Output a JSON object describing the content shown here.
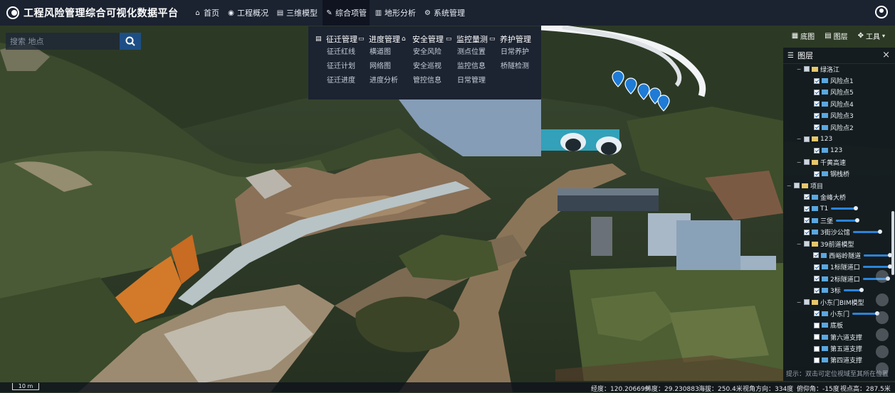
{
  "app_title": "工程风险管理综合可视化数据平台",
  "nav": [
    {
      "label": "首页",
      "icon": "home-icon"
    },
    {
      "label": "工程概况",
      "icon": "eye-icon"
    },
    {
      "label": "三维模型",
      "icon": "document-icon"
    },
    {
      "label": "综合项管",
      "icon": "pencil-icon"
    },
    {
      "label": "地形分析",
      "icon": "chart-icon"
    },
    {
      "label": "系统管理",
      "icon": "gear-icon"
    }
  ],
  "search": {
    "placeholder": "搜索 地点"
  },
  "dropdown": {
    "columns": [
      {
        "header": "征迁管理",
        "icon": "document-icon",
        "items": [
          "征迁红线",
          "征迁计划",
          "征迁进度"
        ]
      },
      {
        "header": "进度管理",
        "icon": "folder-icon",
        "items": [
          "横道图",
          "网络图",
          "进度分析"
        ]
      },
      {
        "header": "安全管理",
        "icon": "bank-icon",
        "items": [
          "安全风险",
          "安全巡视",
          "管控信息"
        ]
      },
      {
        "header": "监控量测",
        "icon": "folder-icon",
        "items": [
          "测点位置",
          "监控信息",
          "日常管理"
        ]
      },
      {
        "header": "养护管理",
        "icon": "folder-icon",
        "items": [
          "日常养护",
          "桥隧检测"
        ]
      }
    ]
  },
  "tools": [
    {
      "label": "底图",
      "icon": "map-icon"
    },
    {
      "label": "图层",
      "icon": "layers-icon"
    },
    {
      "label": "工具",
      "icon": "tools-icon"
    }
  ],
  "layer_panel": {
    "title": "图层",
    "hint": "提示：双击可定位视域至其所在位置",
    "rows": [
      {
        "label": "绿洛江",
        "level": 1,
        "kind": "folder",
        "check": "part",
        "toggle": "⊟"
      },
      {
        "label": "风险点1",
        "level": 2,
        "kind": "item",
        "check": "on"
      },
      {
        "label": "风险点5",
        "level": 2,
        "kind": "item",
        "check": "on"
      },
      {
        "label": "风险点4",
        "level": 2,
        "kind": "item",
        "check": "on"
      },
      {
        "label": "风险点3",
        "level": 2,
        "kind": "item",
        "check": "on"
      },
      {
        "label": "风险点2",
        "level": 2,
        "kind": "item",
        "check": "on"
      },
      {
        "label": "123",
        "level": 1,
        "kind": "folder",
        "check": "part",
        "toggle": "⊟"
      },
      {
        "label": "123",
        "level": 2,
        "kind": "item",
        "check": "on"
      },
      {
        "label": "千黄高速",
        "level": 1,
        "kind": "folder",
        "check": "part",
        "toggle": "⊟"
      },
      {
        "label": "钢栈桥",
        "level": 2,
        "kind": "item",
        "check": "on"
      },
      {
        "label": "项目",
        "level": 0,
        "kind": "folder",
        "check": "part",
        "toggle": "⊟"
      },
      {
        "label": "金峰大桥",
        "level": 1,
        "kind": "item",
        "check": "on"
      },
      {
        "label": "T1",
        "level": 1,
        "kind": "item",
        "check": "on",
        "slider": 0.7
      },
      {
        "label": "三堡",
        "level": 1,
        "kind": "item",
        "check": "on",
        "slider": 0.6
      },
      {
        "label": "3街沙公馆",
        "level": 1,
        "kind": "item",
        "check": "on",
        "slider": 0.75
      },
      {
        "label": "39前道模型",
        "level": 1,
        "kind": "folder",
        "check": "part",
        "toggle": "⊟"
      },
      {
        "label": "西峪岭隧道",
        "level": 2,
        "kind": "item",
        "check": "on",
        "slider": 0.8
      },
      {
        "label": "1标隧道口",
        "level": 2,
        "kind": "item",
        "check": "on",
        "slider": 0.75
      },
      {
        "label": "2标隧道口",
        "level": 2,
        "kind": "item",
        "check": "on",
        "slider": 0.7
      },
      {
        "label": "3标",
        "level": 2,
        "kind": "item",
        "check": "on",
        "slider": 0.5
      },
      {
        "label": "小东门BIM模型",
        "level": 1,
        "kind": "folder",
        "check": "part",
        "toggle": "⊟"
      },
      {
        "label": "小东门",
        "level": 2,
        "kind": "item",
        "check": "on",
        "slider": 0.7
      },
      {
        "label": "底板",
        "level": 2,
        "kind": "item",
        "check": "off"
      },
      {
        "label": "第六道支撑",
        "level": 2,
        "kind": "item",
        "check": "off"
      },
      {
        "label": "第五道支撑",
        "level": 2,
        "kind": "item",
        "check": "off"
      },
      {
        "label": "第四道支撑",
        "level": 2,
        "kind": "item",
        "check": "off"
      }
    ]
  },
  "status": {
    "scale": "10 m",
    "lon": "经度：120.206699",
    "lat": "纬度：29.230883",
    "alt": "海拔：250.4米",
    "heading": "视角方向：334度",
    "pitch": "俯仰角：-15度",
    "height": "视点高：287.5米"
  },
  "colors": {
    "topbar": "#1b2230",
    "accent": "#2b84d9",
    "marker": "#1e7bd6"
  }
}
